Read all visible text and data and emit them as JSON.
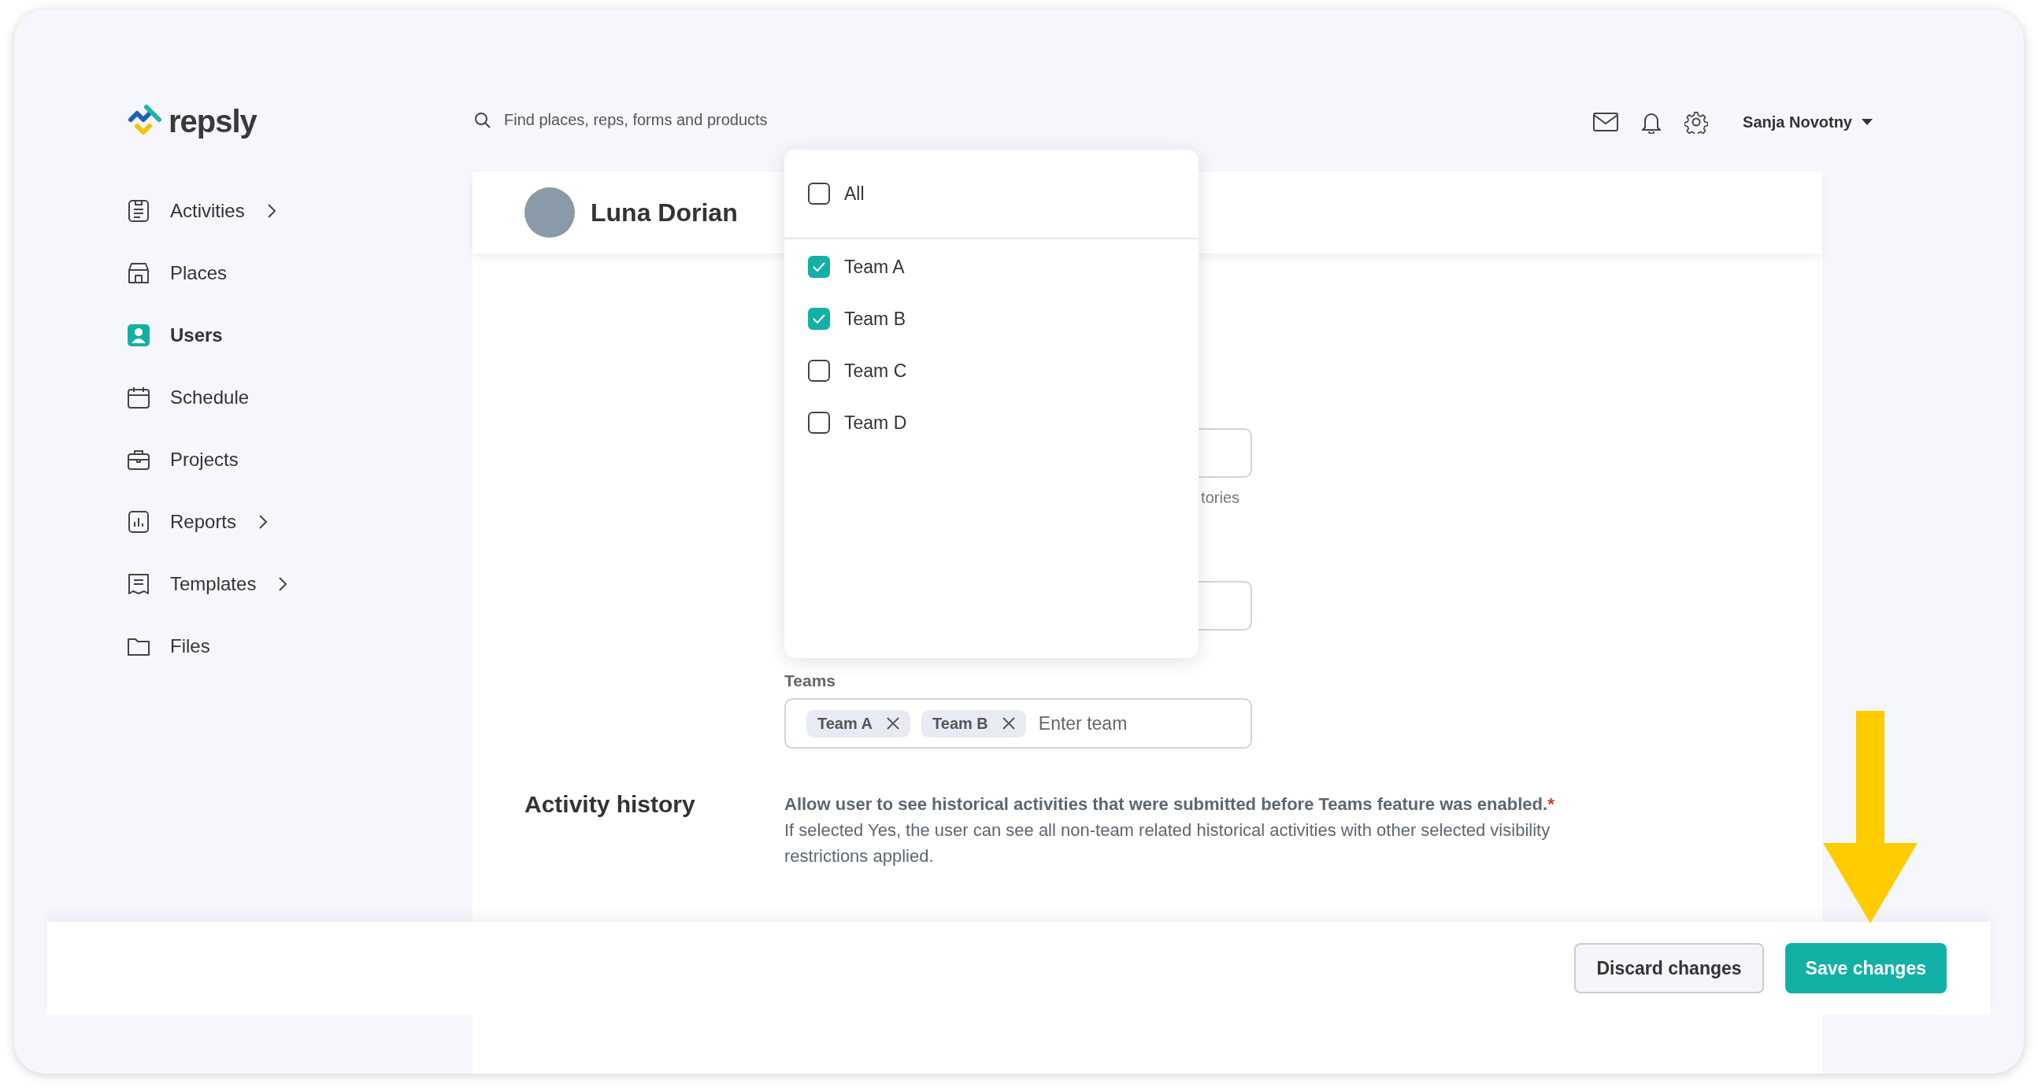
{
  "logo": {
    "text": "repsly"
  },
  "sidebar": {
    "items": [
      {
        "label": "Activities",
        "selected": false,
        "has_submenu": true
      },
      {
        "label": "Places",
        "selected": false,
        "has_submenu": false
      },
      {
        "label": "Users",
        "selected": true,
        "has_submenu": false
      },
      {
        "label": "Schedule",
        "selected": false,
        "has_submenu": false
      },
      {
        "label": "Projects",
        "selected": false,
        "has_submenu": false
      },
      {
        "label": "Reports",
        "selected": false,
        "has_submenu": true
      },
      {
        "label": "Templates",
        "selected": false,
        "has_submenu": true
      },
      {
        "label": "Files",
        "selected": false,
        "has_submenu": false
      }
    ]
  },
  "search": {
    "placeholder": "Find places, reps, forms and products"
  },
  "user_menu": {
    "name": "Sanja Novotny"
  },
  "profile": {
    "name": "Luna Dorian"
  },
  "form": {
    "hint_fragment": "tories",
    "teams": {
      "label": "Teams",
      "chips": [
        "Team A",
        "Team B"
      ],
      "placeholder": "Enter team"
    }
  },
  "team_dropdown": {
    "all": {
      "label": "All",
      "checked": false
    },
    "options": [
      {
        "label": "Team A",
        "checked": true
      },
      {
        "label": "Team B",
        "checked": true
      },
      {
        "label": "Team C",
        "checked": false
      },
      {
        "label": "Team D",
        "checked": false
      }
    ]
  },
  "activity_history": {
    "title": "Activity history",
    "question": "Allow user to see historical activities that were submitted before Teams feature was enabled.",
    "required_mark": "*",
    "description": "If selected Yes, the user can see all non-team related historical activities with other selected visibility restrictions applied."
  },
  "footer": {
    "buttons": [
      {
        "label": "Discard changes",
        "kind": "secondary"
      },
      {
        "label": "Save changes",
        "kind": "primary"
      }
    ]
  }
}
